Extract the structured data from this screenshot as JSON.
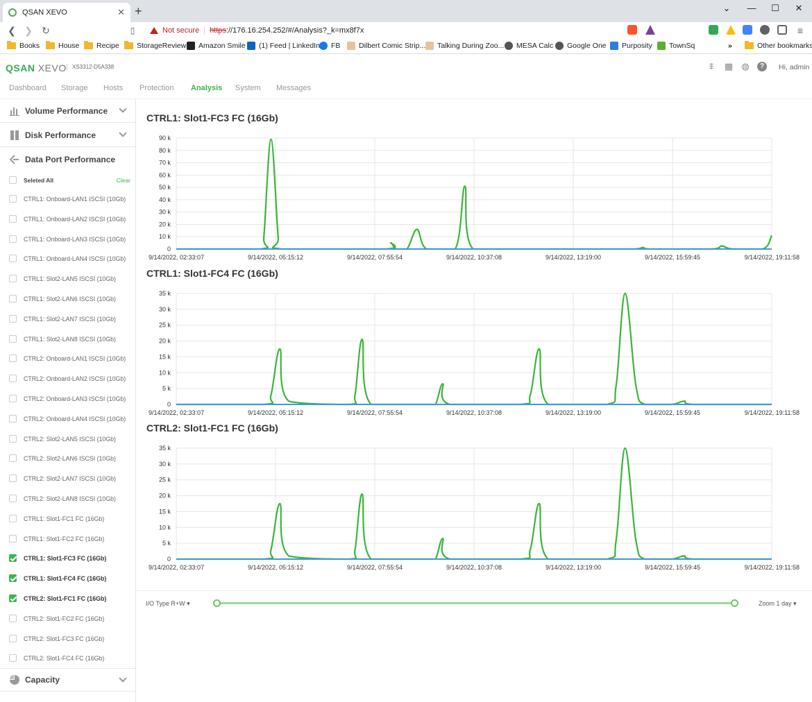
{
  "browser": {
    "tab_title": "QSAN XEVO",
    "not_secure": "Not secure",
    "url_scheme": "https",
    "url_rest": "://176.16.254.252/#/Analysis?_k=mx8f7x",
    "bookmarks": [
      "Books",
      "House",
      "Recipe",
      "StorageReview",
      "Amazon Smile",
      "(1) Feed | LinkedIn",
      "FB",
      "Dilbert Comic Strip...",
      "Talking During Zoo...",
      "MESA Calc",
      "Google One",
      "Purposity",
      "TownSq"
    ],
    "more": "»",
    "other_bookmarks": "Other bookmarks"
  },
  "app": {
    "logo_main": "QSAN",
    "logo_sub": "XEVO",
    "model": "XS3312-D5A338",
    "greeting": "Hi, admin",
    "nav": [
      "Dashboard",
      "Storage",
      "Hosts",
      "Protection",
      "Analysis",
      "System",
      "Messages"
    ],
    "active_nav": "Analysis"
  },
  "sidebar": {
    "sections": {
      "volume": "Volume Performance",
      "disk": "Disk Performance",
      "dataport": "Data Port Performance",
      "capacity": "Capacity"
    },
    "selected_all": "Seleted All",
    "clear": "Clear",
    "ports": [
      {
        "label": "CTRL1: Onboard-LAN1 ISCSI (10Gb)",
        "checked": false
      },
      {
        "label": "CTRL1: Onboard-LAN2 ISCSI (10Gb)",
        "checked": false
      },
      {
        "label": "CTRL1: Onboard-LAN3 ISCSI (10Gb)",
        "checked": false
      },
      {
        "label": "CTRL1: Onboard-LAN4 ISCSI (10Gb)",
        "checked": false
      },
      {
        "label": "CTRL1: Slot2-LAN5 ISCSI (10Gb)",
        "checked": false
      },
      {
        "label": "CTRL1: Slot2-LAN6 ISCSI (10Gb)",
        "checked": false
      },
      {
        "label": "CTRL1: Slot2-LAN7 ISCSI (10Gb)",
        "checked": false
      },
      {
        "label": "CTRL1: Slot2-LAN8 ISCSI (10Gb)",
        "checked": false
      },
      {
        "label": "CTRL2: Onboard-LAN1 ISCSI (10Gb)",
        "checked": false
      },
      {
        "label": "CTRL2: Onboard-LAN2 ISCSI (10Gb)",
        "checked": false
      },
      {
        "label": "CTRL2: Onboard-LAN3 ISCSI (10Gb)",
        "checked": false
      },
      {
        "label": "CTRL2: Onboard-LAN4 ISCSI (10Gb)",
        "checked": false
      },
      {
        "label": "CTRL2: Slot2-LAN5 ISCSI (10Gb)",
        "checked": false
      },
      {
        "label": "CTRL2: Slot2-LAN6 ISCSI (10Gb)",
        "checked": false
      },
      {
        "label": "CTRL2: Slot2-LAN7 ISCSI (10Gb)",
        "checked": false
      },
      {
        "label": "CTRL2: Slot2-LAN8 ISCSI (10Gb)",
        "checked": false
      },
      {
        "label": "CTRL1: Slot1-FC1 FC (16Gb)",
        "checked": false
      },
      {
        "label": "CTRL1: Slot1-FC2 FC (16Gb)",
        "checked": false
      },
      {
        "label": "CTRL1: Slot1-FC3 FC (16Gb)",
        "checked": true
      },
      {
        "label": "CTRL1: Slot1-FC4 FC (16Gb)",
        "checked": true
      },
      {
        "label": "CTRL2: Slot1-FC1 FC (16Gb)",
        "checked": true
      },
      {
        "label": "CTRL2: Slot1-FC2 FC (16Gb)",
        "checked": false
      },
      {
        "label": "CTRL2: Slot1-FC3 FC (16Gb)",
        "checked": false
      },
      {
        "label": "CTRL2: Slot1-FC4 FC (16Gb)",
        "checked": false
      }
    ]
  },
  "controls": {
    "io_type": "I/O Type R+W",
    "zoom": "Zoom 1 day"
  },
  "colors": {
    "accent": "#3ab54a",
    "series_green": "#3ab53a",
    "series_blue": "#3d9bd6"
  },
  "chart_data": [
    {
      "type": "line",
      "title": "CTRL1: Slot1-FC3 FC (16Gb)",
      "x_tick_labels": [
        "9/14/2022, 02:33:07",
        "9/14/2022, 05:15:12",
        "9/14/2022, 07:55:54",
        "9/14/2022, 10:37:08",
        "9/14/2022, 13:19:00",
        "9/14/2022, 15:59:45",
        "9/14/2022, 19:11:58"
      ],
      "y_tick_labels": [
        "0",
        "10 k",
        "20 k",
        "30 k",
        "40 k",
        "50 k",
        "60 k",
        "70 k",
        "80 k",
        "90 k"
      ],
      "ylim": [
        0,
        90000
      ],
      "x_hours": [
        2.55,
        4.9,
        5.0,
        5.2,
        5.4,
        5.5,
        8.4,
        8.55,
        8.7,
        9.0,
        9.28,
        9.55,
        10.35,
        10.62,
        10.85,
        12.4,
        12.7,
        12.95,
        13.2,
        13.6,
        13.8,
        15.3,
        15.6,
        15.85,
        17.5,
        17.8,
        18.1,
        18.95,
        19.2
      ],
      "series": [
        {
          "values": [
            0,
            0,
            10000,
            89000,
            10000,
            0,
            0,
            5000,
            0,
            0,
            16000,
            0,
            0,
            51000,
            0,
            0,
            0,
            0,
            0,
            0,
            0,
            0,
            1200,
            0,
            0,
            2500,
            0,
            0,
            11000
          ]
        },
        {
          "values": [
            0,
            0,
            0,
            0,
            0,
            0,
            0,
            0,
            0,
            0,
            0,
            0,
            0,
            0,
            0,
            0,
            0,
            0,
            0,
            0,
            0,
            0,
            0,
            0,
            0,
            0,
            0,
            0,
            0
          ]
        }
      ]
    },
    {
      "type": "line",
      "title": "CTRL1: Slot1-FC4 FC (16Gb)",
      "x_tick_labels": [
        "9/14/2022, 02:33:07",
        "9/14/2022, 05:15:12",
        "9/14/2022, 07:55:54",
        "9/14/2022, 10:37:08",
        "9/14/2022, 13:19:00",
        "9/14/2022, 15:59:45",
        "9/14/2022, 19:11:58"
      ],
      "y_tick_labels": [
        "0",
        "5 k",
        "10 k",
        "15 k",
        "20 k",
        "25 k",
        "30 k",
        "35 k"
      ],
      "ylim": [
        0,
        35000
      ],
      "x_hours": [
        2.55,
        5.0,
        5.2,
        5.45,
        5.7,
        7.4,
        7.55,
        7.75,
        8.0,
        9.6,
        9.8,
        10.0,
        10.2,
        12.2,
        12.45,
        12.7,
        12.95,
        14.6,
        14.85,
        15.1,
        15.4,
        15.65,
        16.4,
        16.75,
        17.05,
        19.2
      ],
      "series": [
        {
          "values": [
            0,
            0,
            3000,
            17500,
            1000,
            0,
            3000,
            20500,
            0,
            0,
            0,
            6500,
            0,
            0,
            3000,
            17500,
            0,
            0,
            6000,
            35000,
            6000,
            0,
            0,
            1000,
            0,
            0
          ]
        },
        {
          "values": [
            0,
            0,
            0,
            0,
            0,
            0,
            0,
            0,
            0,
            0,
            0,
            0,
            0,
            0,
            0,
            0,
            0,
            0,
            0,
            0,
            0,
            0,
            0,
            0,
            0,
            0
          ]
        }
      ]
    },
    {
      "type": "line",
      "title": "CTRL2: Slot1-FC1 FC (16Gb)",
      "x_tick_labels": [
        "9/14/2022, 02:33:07",
        "9/14/2022, 05:15:12",
        "9/14/2022, 07:55:54",
        "9/14/2022, 10:37:08",
        "9/14/2022, 13:19:00",
        "9/14/2022, 15:59:45",
        "9/14/2022, 19:11:58"
      ],
      "y_tick_labels": [
        "0",
        "5 k",
        "10 k",
        "15 k",
        "20 k",
        "25 k",
        "30 k",
        "35 k"
      ],
      "ylim": [
        0,
        35000
      ],
      "x_hours": [
        2.55,
        5.0,
        5.2,
        5.45,
        5.7,
        7.4,
        7.55,
        7.75,
        8.0,
        9.6,
        9.8,
        10.0,
        10.2,
        12.2,
        12.45,
        12.7,
        12.95,
        14.6,
        14.85,
        15.1,
        15.4,
        15.65,
        16.4,
        16.75,
        17.05,
        19.2
      ],
      "series": [
        {
          "values": [
            0,
            0,
            3000,
            17500,
            1000,
            0,
            3000,
            20500,
            0,
            0,
            0,
            6500,
            0,
            0,
            3000,
            17500,
            0,
            0,
            6000,
            35000,
            6000,
            0,
            0,
            1000,
            0,
            0
          ]
        },
        {
          "values": [
            0,
            0,
            0,
            0,
            0,
            0,
            0,
            0,
            0,
            0,
            0,
            0,
            0,
            0,
            0,
            0,
            0,
            0,
            0,
            0,
            0,
            0,
            0,
            0,
            0,
            0
          ]
        }
      ]
    }
  ]
}
